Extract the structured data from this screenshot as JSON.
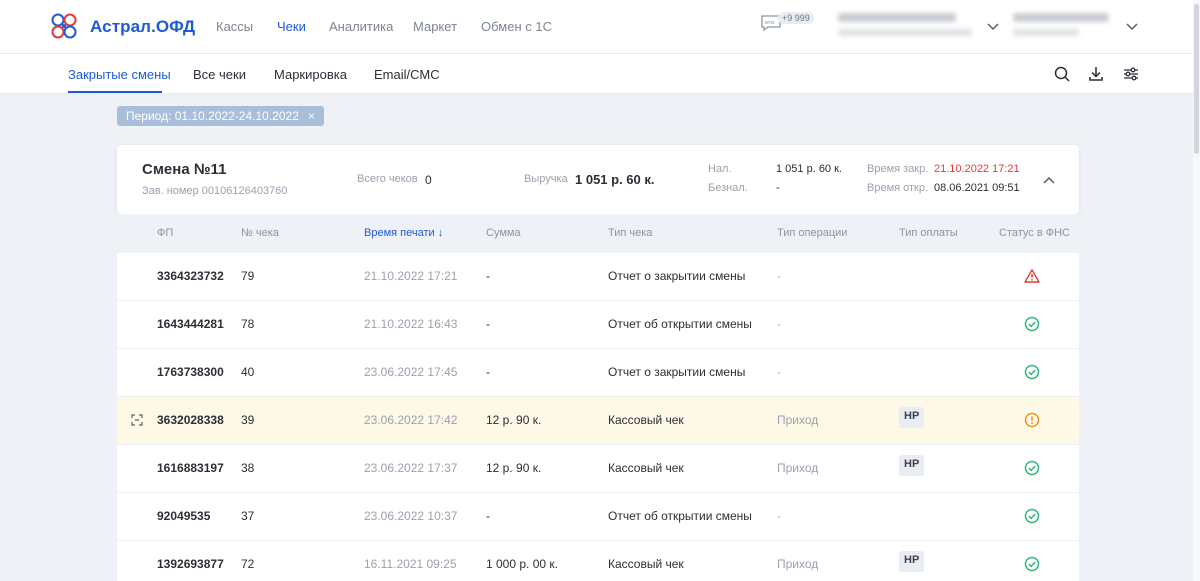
{
  "header": {
    "brand": "Астрал.ОФД",
    "nav": [
      "Кассы",
      "Чеки",
      "Аналитика",
      "Маркет",
      "Обмен с 1С"
    ],
    "active_nav": 1,
    "sms_label": "sms",
    "sms_count": "+9 999",
    "org_line1": "Юридическое лицо ОТ",
    "org_line2": "как разобрать юзеризацию",
    "user_line1": "Владимиров Т.",
    "user_line2": "Администрат"
  },
  "tabs": {
    "items": [
      "Закрытые смены",
      "Все чеки",
      "Маркировка",
      "Email/СМС"
    ],
    "active": 0
  },
  "filter": {
    "chip_label": "Период: 01.10.2022-24.10.2022",
    "chip_close": "×"
  },
  "shift": {
    "title": "Смена №11",
    "serial": "Зав. номер 00106126403760",
    "total_checks_label": "Всего чеков",
    "total_checks_value": "0",
    "revenue_label": "Выручка",
    "revenue_value": "1 051 р. 60 к.",
    "cash_label": "Нал.",
    "cash_value": "1 051 р. 60 к.",
    "noncash_label": "Безнал.",
    "noncash_value": "-",
    "close_label": "Время закр.",
    "close_value": "21.10.2022 17:21",
    "open_label": "Время откр.",
    "open_value": "08.06.2021 09:51"
  },
  "table": {
    "headers": [
      "ФП",
      "№ чека",
      "Время печати",
      "Сумма",
      "Тип чека",
      "Тип операции",
      "Тип оплаты",
      "Статус в ФНС"
    ],
    "sort_arrow": "↓",
    "rows": [
      {
        "fp": "3364323732",
        "num": "79",
        "time": "21.10.2022 17:21",
        "sum": "-",
        "type": "Отчет о закрытии смены",
        "op": "-",
        "pay": "",
        "status": "error"
      },
      {
        "fp": "1643444281",
        "num": "78",
        "time": "21.10.2022 16:43",
        "sum": "-",
        "type": "Отчет об открытии смены",
        "op": "-",
        "pay": "",
        "status": "ok"
      },
      {
        "fp": "1763738300",
        "num": "40",
        "time": "23.06.2022 17:45",
        "sum": "-",
        "type": "Отчет о закрытии смены",
        "op": "-",
        "pay": "",
        "status": "ok"
      },
      {
        "fp": "3632028338",
        "num": "39",
        "time": "23.06.2022 17:42",
        "sum": "12 р. 90 к.",
        "type": "Кассовый чек",
        "op": "Приход",
        "pay": "НР",
        "status": "warning"
      },
      {
        "fp": "1616883197",
        "num": "38",
        "time": "23.06.2022 17:37",
        "sum": "12 р. 90 к.",
        "type": "Кассовый чек",
        "op": "Приход",
        "pay": "НР",
        "status": "ok"
      },
      {
        "fp": "92049535",
        "num": "37",
        "time": "23.06.2022 10:37",
        "sum": "-",
        "type": "Отчет об открытии смены",
        "op": "-",
        "pay": "",
        "status": "ok"
      },
      {
        "fp": "1392693877",
        "num": "72",
        "time": "16.11.2021 09:25",
        "sum": "1 000 р. 00 к.",
        "type": "Кассовый чек",
        "op": "Приход",
        "pay": "НР",
        "status": "ok"
      }
    ]
  },
  "colors": {
    "accent": "#1d5bd6",
    "ok": "#2eb872",
    "warning": "#f0901e",
    "error": "#e53935",
    "highlight_row": "#fdf9e6"
  }
}
